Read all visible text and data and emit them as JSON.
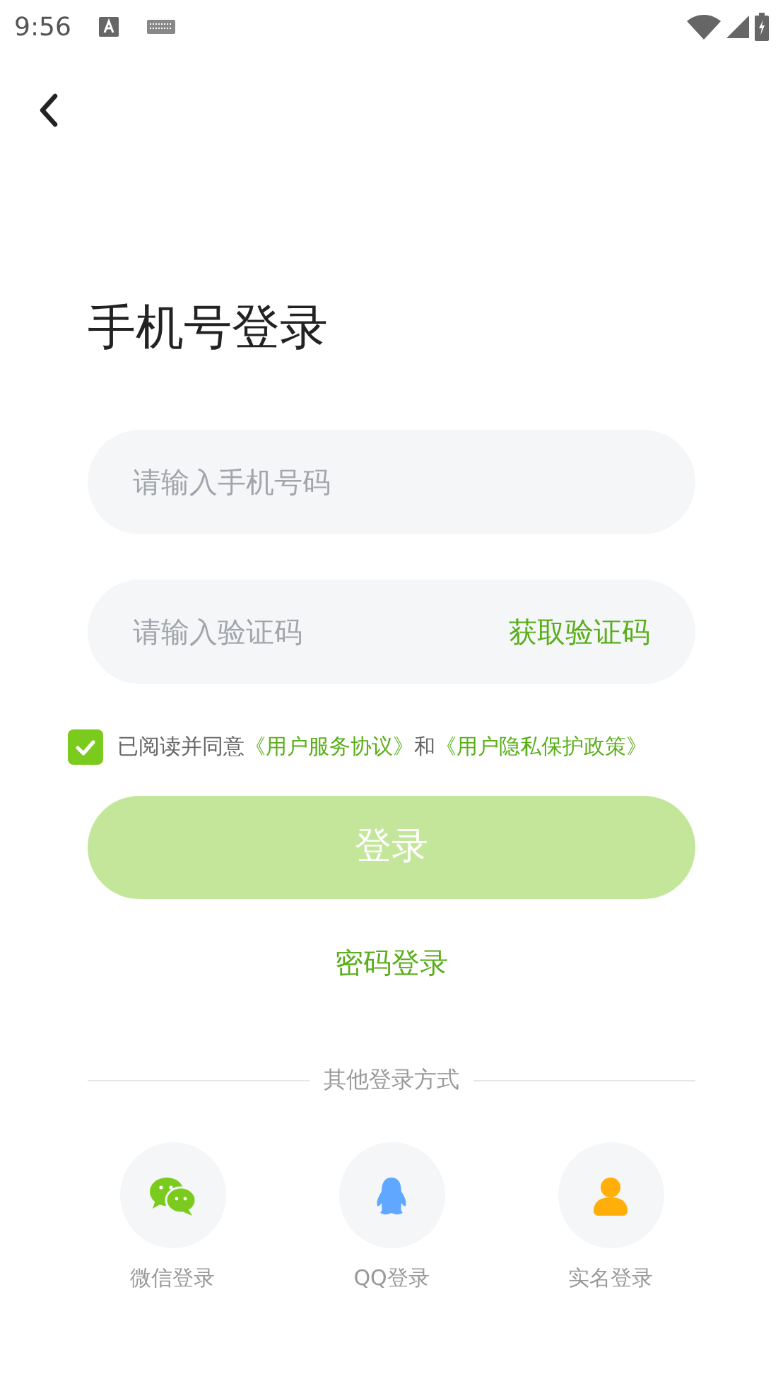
{
  "status_bar": {
    "time": "9:56"
  },
  "title": "手机号登录",
  "phone_field": {
    "placeholder": "请输入手机号码"
  },
  "code_field": {
    "placeholder": "请输入验证码",
    "action": "获取验证码"
  },
  "agreement": {
    "checked": true,
    "parts": [
      {
        "kind": "text",
        "text": "已阅读并同意"
      },
      {
        "kind": "link",
        "text": "《用户服务协议》"
      },
      {
        "kind": "text",
        "text": "和"
      },
      {
        "kind": "link",
        "text": "《用户隐私保护政策》"
      }
    ]
  },
  "login_button": {
    "label": "登录",
    "disabled": true
  },
  "password_login": "密码登录",
  "other_methods": {
    "title": "其他登录方式",
    "items": [
      {
        "kind": "wechat",
        "label": "微信登录"
      },
      {
        "kind": "qq",
        "label": "QQ登录"
      },
      {
        "kind": "person",
        "label": "实名登录"
      }
    ]
  }
}
